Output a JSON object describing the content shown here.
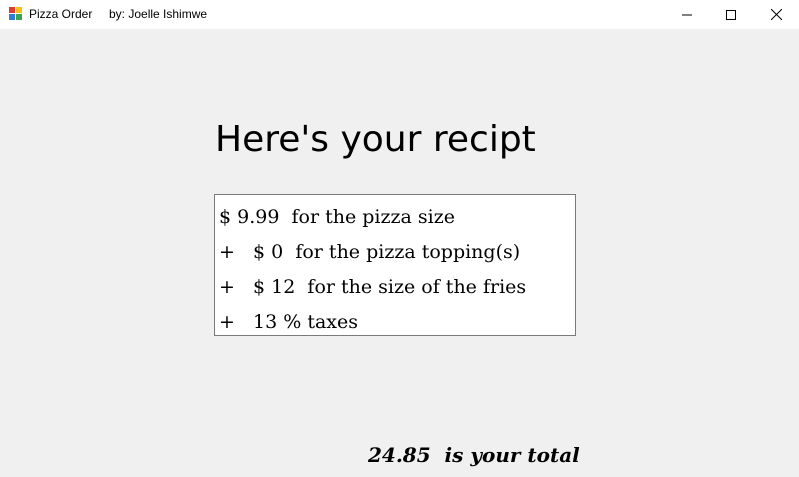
{
  "window": {
    "app_title": "Pizza Order",
    "author": "by: Joelle Ishimwe",
    "icon": "app-form-icon",
    "controls": [
      "minimize-icon",
      "maximize-icon",
      "close-icon"
    ]
  },
  "receipt": {
    "heading": "Here's your recipt",
    "lines": [
      "$ 9.99  for the pizza size",
      "+   $ 0  for the pizza topping(s)",
      "+   $ 12  for the size of the fries",
      "+   13 % taxes"
    ],
    "total": "24.85  is your total"
  },
  "colors": {
    "background": "#f0f0f0",
    "titlebar": "#ffffff",
    "box_border": "#7a7a7a"
  }
}
